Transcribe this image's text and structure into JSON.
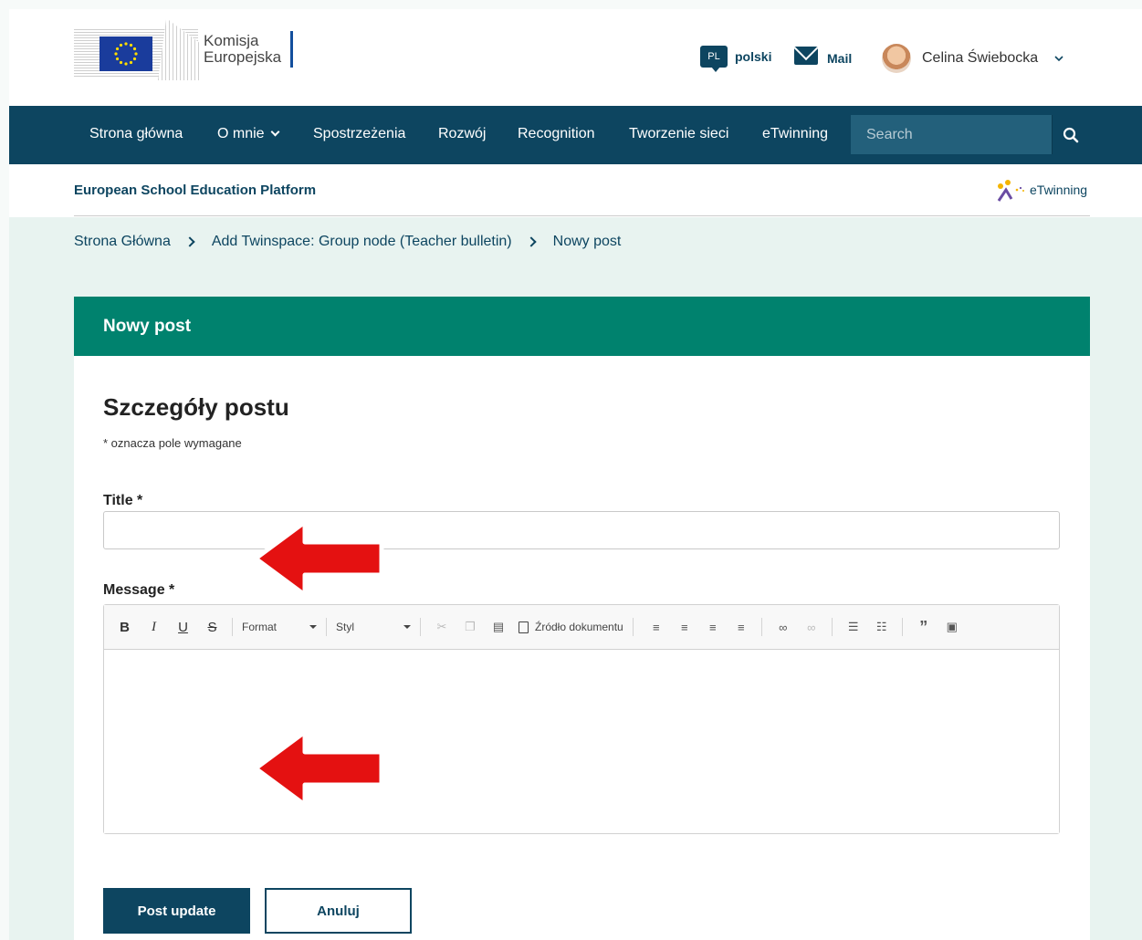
{
  "header": {
    "logo_text_line1": "Komisja",
    "logo_text_line2": "Europejska",
    "language_code": "PL",
    "language_label": "polski",
    "mail_label": "Mail",
    "user_name": "Celina Świebocka"
  },
  "nav": {
    "items": [
      "Strona główna",
      "O mnie",
      "Spostrzeżenia",
      "Rozwój",
      "Recognition",
      "Tworzenie sieci",
      "eTwinning"
    ],
    "search_placeholder": "Search"
  },
  "subheader": {
    "platform_title": "European School Education Platform",
    "etwinning_label": "eTwinning"
  },
  "breadcrumb": [
    "Strona Główna",
    "Add Twinspace: Group node (Teacher bulletin)",
    "Nowy post"
  ],
  "card": {
    "header_title": "Nowy post",
    "section_title": "Szczegóły postu",
    "required_note": "* oznacza pole wymagane",
    "title_label": "Title *",
    "title_value": "",
    "message_label": "Message *",
    "message_value": ""
  },
  "editor_toolbar": {
    "bold": "B",
    "italic": "I",
    "underline": "U",
    "strike": "S",
    "format_label": "Format",
    "style_label": "Styl",
    "source_label": "Źródło dokumentu"
  },
  "buttons": {
    "submit": "Post update",
    "cancel": "Anuluj"
  },
  "colors": {
    "primary": "#0d4560",
    "card_header": "#00826e",
    "page_bg": "#e8f3f0",
    "arrow": "#e41111"
  }
}
